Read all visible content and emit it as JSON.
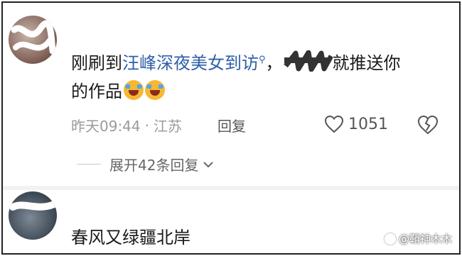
{
  "comment1": {
    "prefix": "刚刷到",
    "link_text": "汪峰深夜美女到访",
    "after_redact": "就推送你",
    "line2": "的作品",
    "time": "昨天09:44",
    "dot": "·",
    "location": "江苏",
    "reply_label": "回复",
    "like_count": "1051",
    "emoji_icon": "crying-laughing-emoji"
  },
  "expand": {
    "label": "展开42条回复"
  },
  "comment2": {
    "text": "春风又绿疆北岸"
  },
  "watermark": {
    "text": "@鞘神木木"
  },
  "colors": {
    "link": "#2f5fa7",
    "meta": "#9a9a9a"
  }
}
